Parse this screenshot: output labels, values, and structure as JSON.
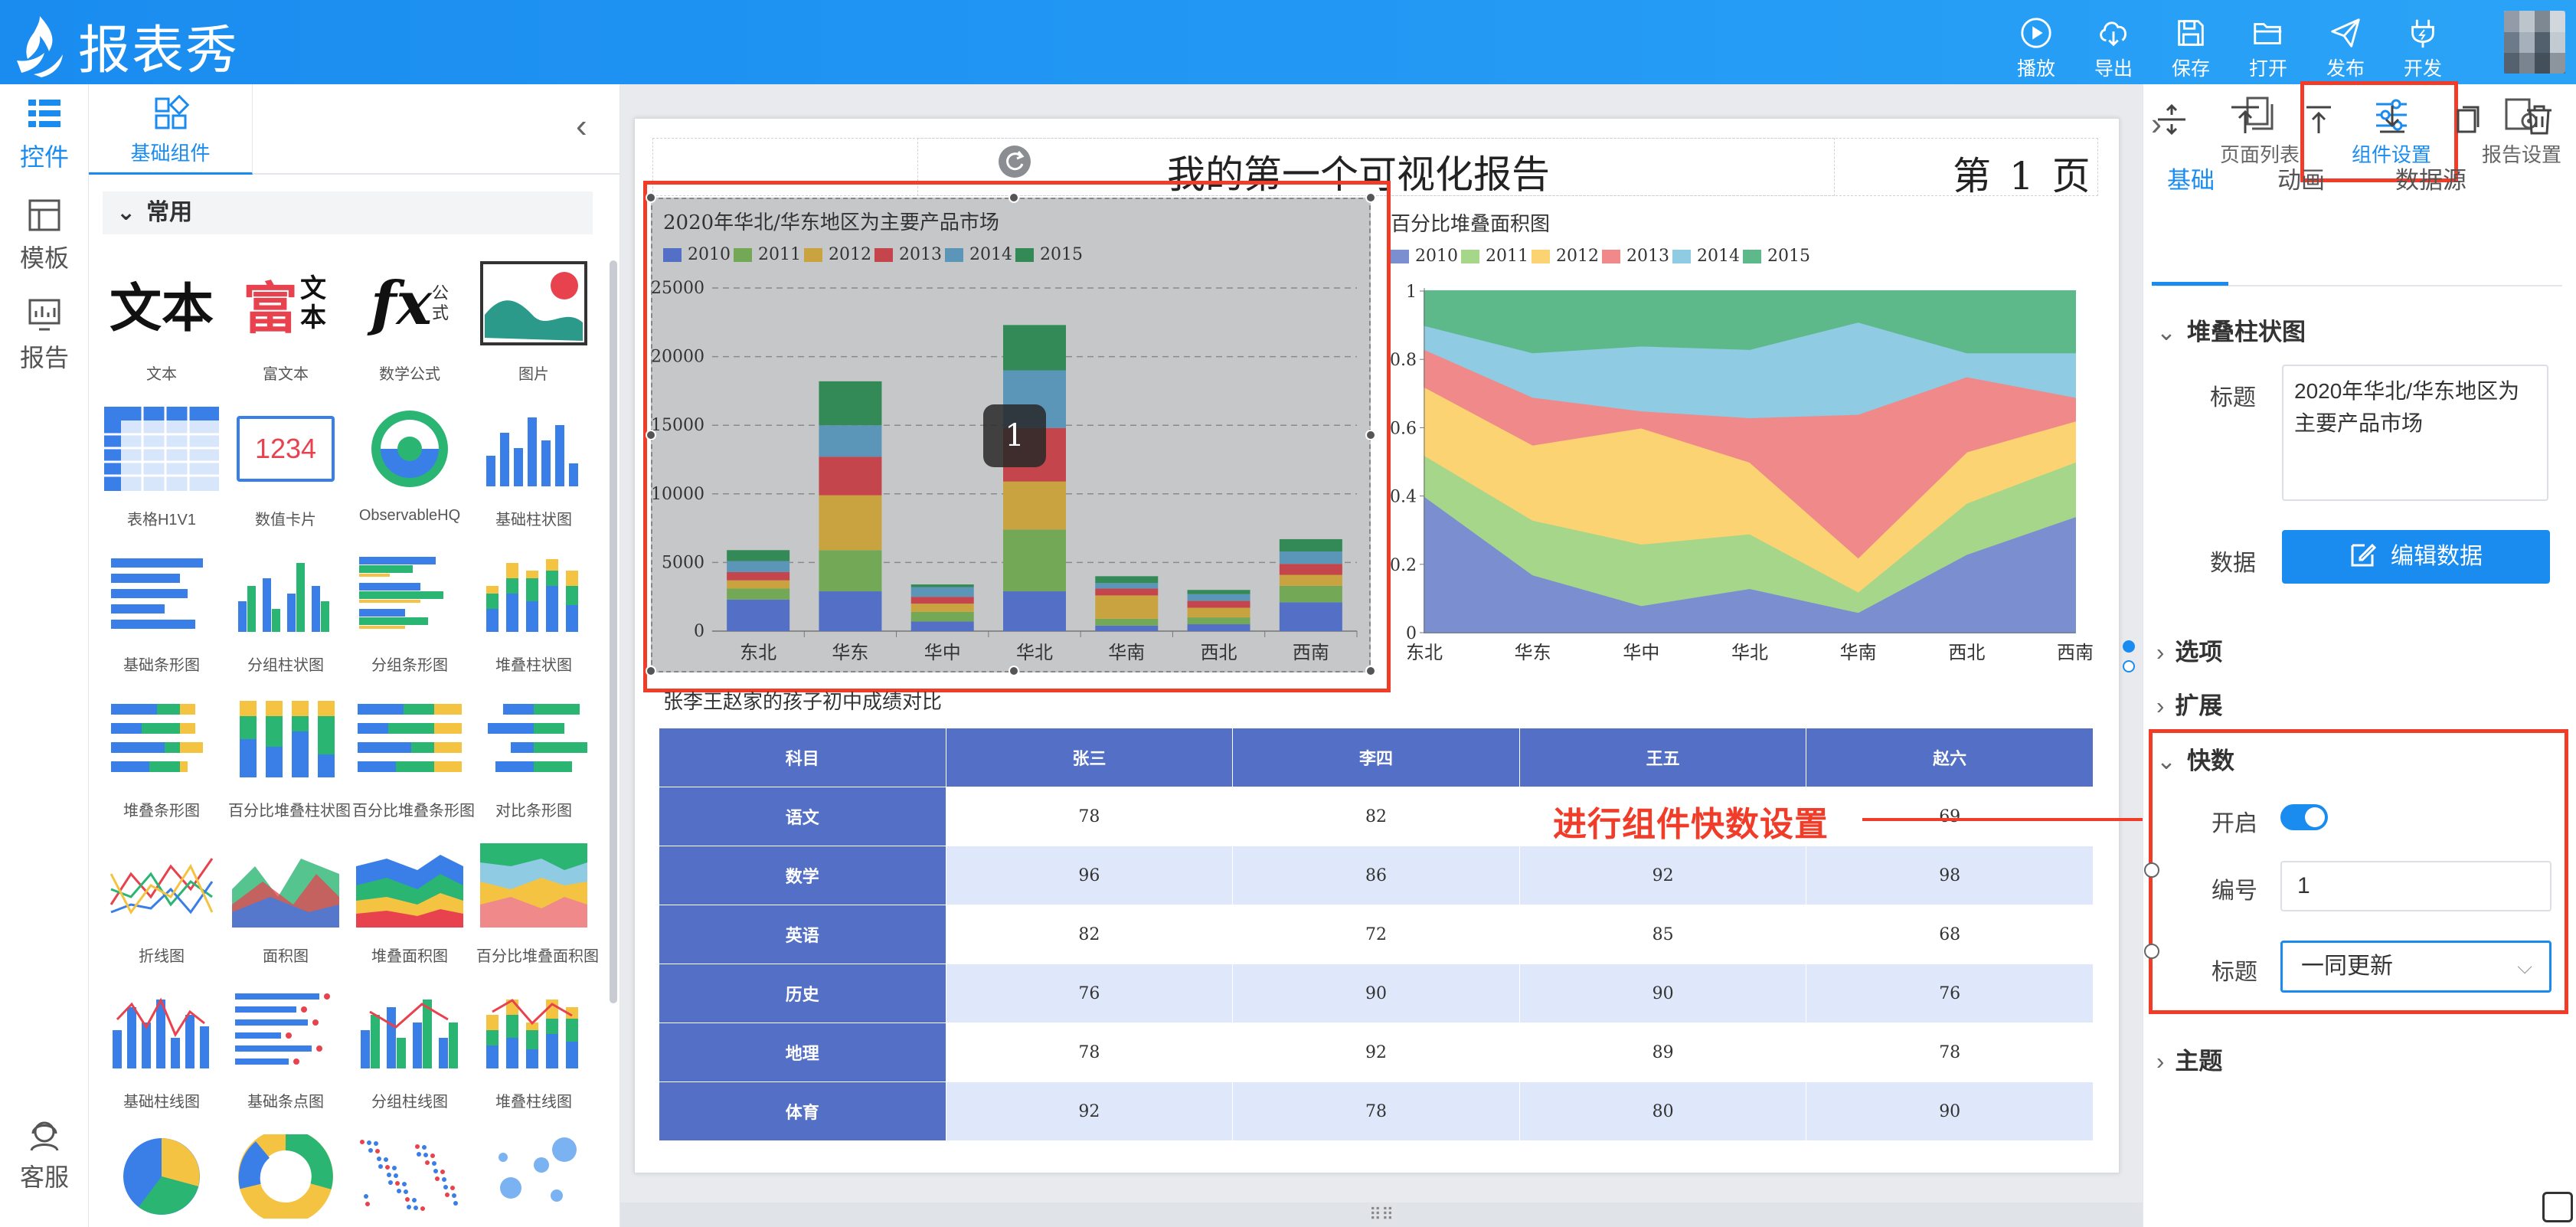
{
  "app": {
    "name": "报表秀"
  },
  "toolbar": [
    {
      "id": "play",
      "label": "播放",
      "icon": "play-icon"
    },
    {
      "id": "export",
      "label": "导出",
      "icon": "cloud-download-icon"
    },
    {
      "id": "save",
      "label": "保存",
      "icon": "save-icon"
    },
    {
      "id": "open",
      "label": "打开",
      "icon": "folder-open-icon"
    },
    {
      "id": "publish",
      "label": "发布",
      "icon": "send-icon"
    },
    {
      "id": "develop",
      "label": "开发",
      "icon": "plug-icon"
    }
  ],
  "rail": {
    "items": [
      {
        "label": "控件",
        "icon": "widgets-icon",
        "active": true
      },
      {
        "label": "模板",
        "icon": "template-icon",
        "active": false
      },
      {
        "label": "报告",
        "icon": "report-icon",
        "active": false
      }
    ],
    "support": {
      "label": "客服",
      "icon": "customer-service-icon"
    }
  },
  "components": {
    "tab": "基础组件",
    "section": "常用",
    "items": [
      {
        "label": "文本"
      },
      {
        "label": "富文本"
      },
      {
        "label": "数学公式"
      },
      {
        "label": "图片"
      },
      {
        "label": "表格H1V1"
      },
      {
        "label": "数值卡片"
      },
      {
        "label": "ObservableHQ"
      },
      {
        "label": "基础柱状图"
      },
      {
        "label": "基础条形图"
      },
      {
        "label": "分组柱状图"
      },
      {
        "label": "分组条形图"
      },
      {
        "label": "堆叠柱状图"
      },
      {
        "label": "堆叠条形图"
      },
      {
        "label": "百分比堆叠柱状图"
      },
      {
        "label": "百分比堆叠条形图"
      },
      {
        "label": "对比条形图"
      },
      {
        "label": "折线图"
      },
      {
        "label": "面积图"
      },
      {
        "label": "堆叠面积图"
      },
      {
        "label": "百分比堆叠面积图"
      },
      {
        "label": "基础柱线图"
      },
      {
        "label": "基础条点图"
      },
      {
        "label": "分组柱线图"
      },
      {
        "label": "堆叠柱线图"
      },
      {
        "label": ""
      },
      {
        "label": ""
      },
      {
        "label": ""
      },
      {
        "label": ""
      }
    ],
    "thumb_text": {
      "text_big": "文本",
      "rich_1": "富",
      "rich_2": "文本",
      "formula": "fx",
      "formula_side": "公式",
      "number_card": "1234"
    }
  },
  "report": {
    "title": "我的第一个可视化报告",
    "page_label": "第 1 页",
    "selected_badge": "1"
  },
  "chart_data": [
    {
      "type": "bar",
      "stacked": true,
      "title": "2020年华北/华东地区为主要产品市场",
      "categories": [
        "东北",
        "华东",
        "华中",
        "华北",
        "华南",
        "西北",
        "西南"
      ],
      "series": [
        {
          "name": "2010",
          "values": [
            2300,
            2900,
            700,
            2900,
            400,
            500,
            2100
          ]
        },
        {
          "name": "2011",
          "values": [
            800,
            3000,
            700,
            4500,
            500,
            500,
            1200
          ]
        },
        {
          "name": "2012",
          "values": [
            600,
            4000,
            600,
            3500,
            1700,
            700,
            800
          ]
        },
        {
          "name": "2013",
          "values": [
            600,
            2800,
            500,
            3900,
            500,
            500,
            800
          ]
        },
        {
          "name": "2014",
          "values": [
            800,
            2300,
            700,
            4200,
            400,
            500,
            900
          ]
        },
        {
          "name": "2015",
          "values": [
            800,
            3200,
            200,
            3300,
            500,
            300,
            900
          ]
        }
      ],
      "ylim": [
        0,
        25000
      ],
      "yticks": [
        0,
        5000,
        10000,
        15000,
        20000,
        25000
      ],
      "legend": "top-left",
      "grid": true,
      "colors": [
        "#5470c6",
        "#73a857",
        "#c9a340",
        "#c4454b",
        "#5b95b8",
        "#338a57"
      ]
    },
    {
      "type": "area",
      "stacked": true,
      "percent": true,
      "title": "百分比堆叠面积图",
      "categories": [
        "东北",
        "华东",
        "华中",
        "华北",
        "华南",
        "西北",
        "西南"
      ],
      "series": [
        {
          "name": "2010",
          "values": [
            0.4,
            0.17,
            0.08,
            0.13,
            0.06,
            0.23,
            0.34
          ]
        },
        {
          "name": "2011",
          "values": [
            0.12,
            0.16,
            0.18,
            0.16,
            0.06,
            0.15,
            0.16
          ]
        },
        {
          "name": "2012",
          "values": [
            0.2,
            0.22,
            0.34,
            0.21,
            0.1,
            0.15,
            0.12
          ]
        },
        {
          "name": "2013",
          "values": [
            0.11,
            0.14,
            0.05,
            0.13,
            0.42,
            0.22,
            0.07
          ]
        },
        {
          "name": "2014",
          "values": [
            0.07,
            0.13,
            0.19,
            0.2,
            0.27,
            0.07,
            0.13
          ]
        },
        {
          "name": "2015",
          "values": [
            0.1,
            0.18,
            0.16,
            0.17,
            0.09,
            0.18,
            0.18
          ]
        }
      ],
      "ylim": [
        0,
        1
      ],
      "yticks": [
        "0",
        "0.2",
        "0.4",
        "0.6",
        "0.8",
        "1"
      ],
      "legend": "top-left",
      "colors": [
        "#7b8fd0",
        "#a6d68a",
        "#fcd372",
        "#f08a8a",
        "#8fcbe2",
        "#5db98a"
      ]
    }
  ],
  "table": {
    "title": "张李王赵家的孩子初中成绩对比",
    "headers": [
      "科目",
      "张三",
      "李四",
      "王五",
      "赵六"
    ],
    "rows": [
      [
        "语文",
        "78",
        "82",
        "",
        "69"
      ],
      [
        "数学",
        "96",
        "86",
        "92",
        "98"
      ],
      [
        "英语",
        "82",
        "72",
        "85",
        "68"
      ],
      [
        "历史",
        "76",
        "90",
        "90",
        "76"
      ],
      [
        "地理",
        "78",
        "92",
        "89",
        "78"
      ],
      [
        "体育",
        "92",
        "78",
        "80",
        "90"
      ]
    ]
  },
  "right_panel": {
    "tabs": [
      {
        "label": "页面列表",
        "icon": "pages-icon",
        "active": false
      },
      {
        "label": "组件设置",
        "icon": "sliders-icon",
        "active": true
      },
      {
        "label": "报告设置",
        "icon": "report-settings-icon",
        "active": false
      }
    ],
    "prop_tabs": [
      "基础",
      "动画",
      "数据源"
    ],
    "group_title": "堆叠柱状图",
    "title_label": "标题",
    "title_value": "2020年华北/华东地区为主要产品市场",
    "data_label": "数据",
    "edit_data_label": "编辑数据",
    "sections": [
      "选项",
      "扩展",
      "快数",
      "主题"
    ],
    "quick": {
      "enable_label": "开启",
      "enabled": true,
      "number_label": "编号",
      "number_value": "1",
      "title_label": "标题",
      "title_value": "一同更新"
    }
  },
  "annotation": {
    "text": "进行组件快数设置",
    "color": "#f03c28"
  }
}
